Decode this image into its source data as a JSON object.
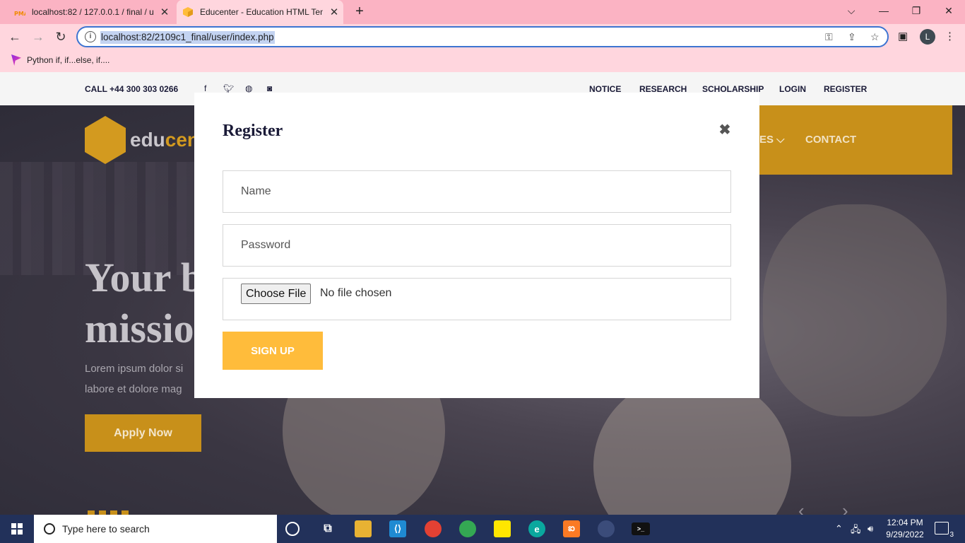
{
  "browser": {
    "tabs": [
      {
        "title": "localhost:82 / 127.0.0.1 / final / u",
        "favicon": "phpmyadmin-icon",
        "active": false
      },
      {
        "title": "Educenter - Education HTML Tem",
        "favicon": "educenter-icon",
        "active": true
      }
    ],
    "url": "localhost:82/2109c1_final/user/index.php",
    "bookmark": "Python if, if...else, if....",
    "profile_initial": "L"
  },
  "site": {
    "topbar": {
      "phone": "CALL +44 300 303 0266",
      "links": [
        "NOTICE",
        "RESEARCH",
        "SCHOLARSHIP",
        "LOGIN",
        "REGISTER"
      ]
    },
    "logo_part1": "edu",
    "logo_part2": "cen",
    "nav_partial": "ES ⌵",
    "nav_contact": "CONTACT",
    "hero_line1": "Your b",
    "hero_line2": "missio",
    "hero_text1": "Lorem ipsum dolor si",
    "hero_text2": "labore et dolore mag",
    "apply_label": "Apply Now"
  },
  "modal": {
    "title": "Register",
    "close": "✖",
    "name_placeholder": "Name",
    "password_placeholder": "Password",
    "file_button": "Choose File",
    "file_status": "No file chosen",
    "submit_label": "SIGN UP"
  },
  "taskbar": {
    "search_placeholder": "Type here to search",
    "time": "12:04 PM",
    "date": "9/29/2022",
    "notifications": "3"
  },
  "colors": {
    "accent": "#ffbc3b",
    "tab_bar": "#fbb3c3",
    "omnibox_border": "#3d74d1",
    "taskbar": "#22315a"
  }
}
